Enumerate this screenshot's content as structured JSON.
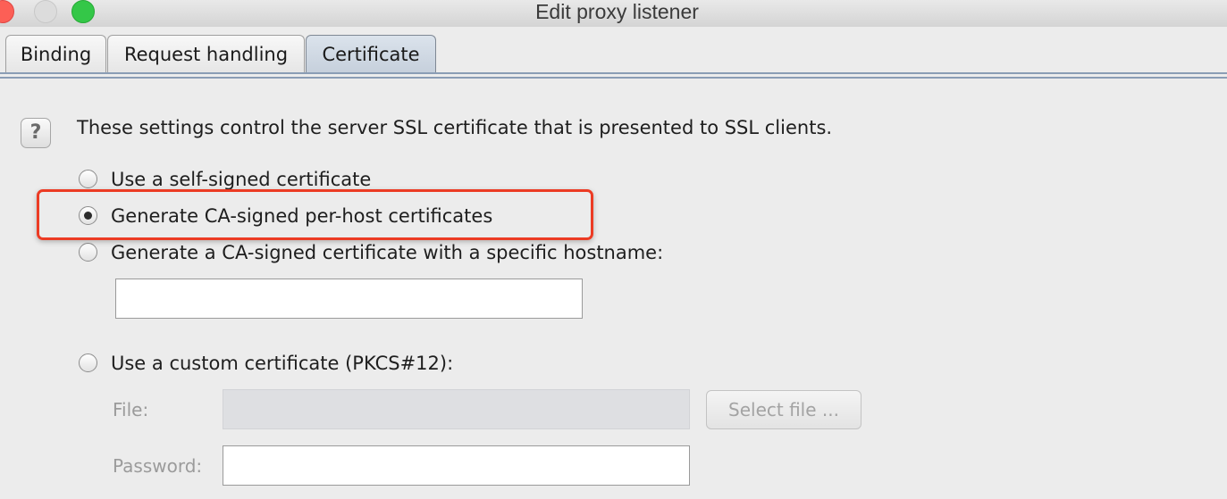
{
  "window": {
    "title": "Edit proxy listener"
  },
  "tabs": [
    {
      "label": "Binding",
      "selected": false
    },
    {
      "label": "Request handling",
      "selected": false
    },
    {
      "label": "Certificate",
      "selected": true
    }
  ],
  "certificate": {
    "help_icon": "?",
    "description": "These settings control the server SSL certificate that is presented to SSL clients.",
    "options": [
      {
        "label": "Use a self-signed certificate",
        "selected": false
      },
      {
        "label": "Generate CA-signed per-host certificates",
        "selected": true
      },
      {
        "label": "Generate a CA-signed certificate with a specific hostname:",
        "selected": false
      },
      {
        "label": "Use a custom certificate (PKCS#12):",
        "selected": false
      }
    ],
    "hostname_value": "",
    "file_label": "File:",
    "file_value": "",
    "select_file_label": "Select file ...",
    "password_label": "Password:",
    "password_value": ""
  },
  "colors": {
    "highlight_border": "#ec3b24",
    "selected_tab": "#c9d3de",
    "tab_rule": "#8a9db5"
  }
}
